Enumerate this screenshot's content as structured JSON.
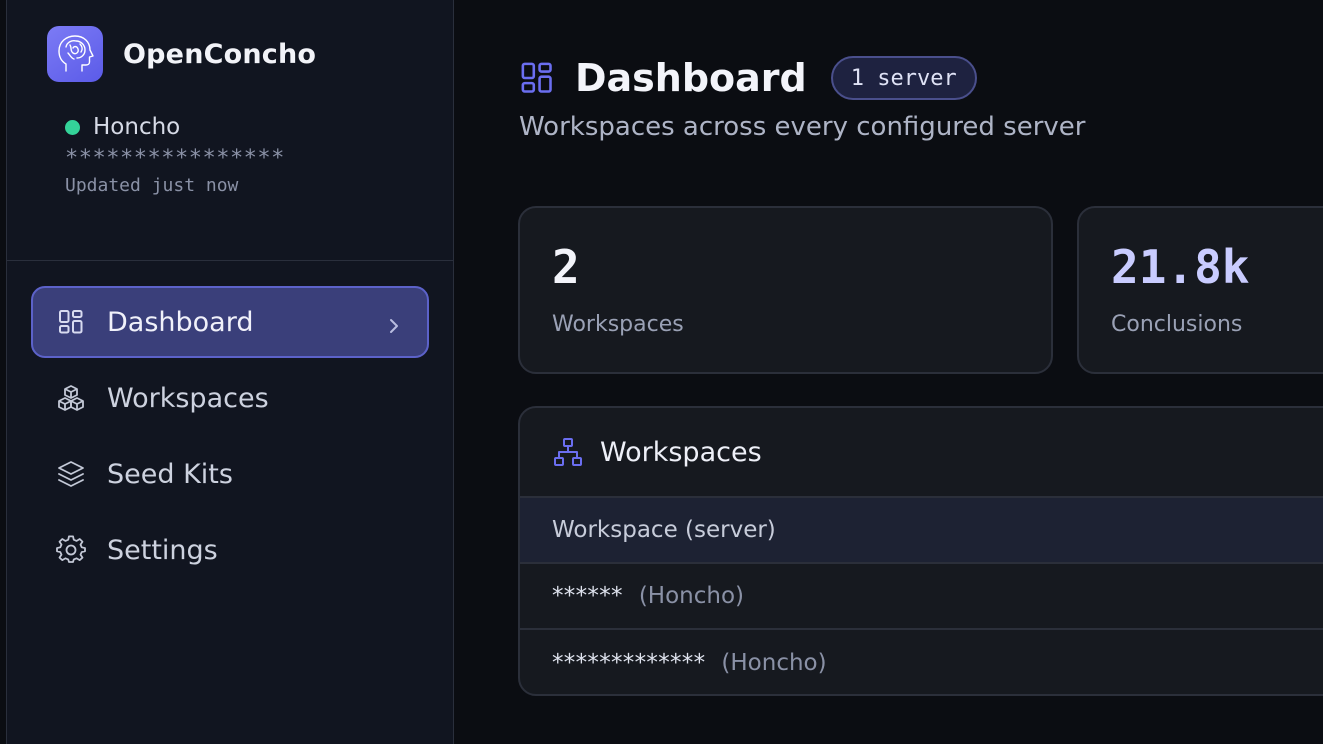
{
  "app": {
    "name": "OpenConcho"
  },
  "server": {
    "name": "Honcho",
    "key": "****************",
    "updated": "Updated just now",
    "status_color": "#34d399"
  },
  "nav": {
    "items": [
      {
        "label": "Dashboard",
        "icon": "dashboard-icon",
        "active": true
      },
      {
        "label": "Workspaces",
        "icon": "boxes-icon",
        "active": false
      },
      {
        "label": "Seed Kits",
        "icon": "layers-icon",
        "active": false
      },
      {
        "label": "Settings",
        "icon": "gear-icon",
        "active": false
      }
    ]
  },
  "header": {
    "title": "Dashboard",
    "badge": "1 server",
    "subtitle": "Workspaces across every configured server"
  },
  "stats": [
    {
      "value": "2",
      "label": "Workspaces"
    },
    {
      "value": "21.8k",
      "label": "Conclusions"
    }
  ],
  "workspaces_panel": {
    "title": "Workspaces",
    "column_header": "Workspace (server)",
    "rows": [
      {
        "name": "******",
        "server": "(Honcho)"
      },
      {
        "name": "*************",
        "server": "(Honcho)"
      }
    ]
  },
  "colors": {
    "accent": "#6b6ef0",
    "active_nav_bg": "#3a3f7a",
    "background": "#0b0d12",
    "sidebar_bg": "#111520"
  }
}
